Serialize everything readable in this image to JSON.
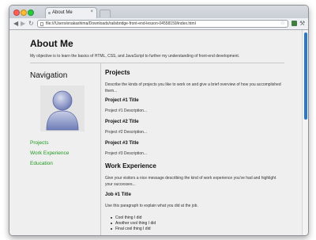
{
  "browser": {
    "tab_title": "About Me",
    "tab_close": "×",
    "url": "file:///Users/enakashima/Downloads/railsbridge-front-end-lesson-04558159/index.html",
    "colors": {
      "close": "#ff5f57",
      "minimize": "#febc2e",
      "zoom": "#28c840",
      "ext1": "#3f7f3f",
      "ext2": "#c44"
    }
  },
  "page": {
    "title": "About Me",
    "objective": "My objective is to learn the basics of HTML, CSS, and JavaScript to further my understanding of front-end development."
  },
  "nav": {
    "title": "Navigation",
    "links": [
      "Projects",
      "Work Experience",
      "Education"
    ],
    "link_color": "#1f9a1f"
  },
  "projects": {
    "heading": "Projects",
    "intro": "Describe the kinds of projects you like to work on and give a brief overview of how you accomplished them...",
    "items": [
      {
        "title": "Project #1 Title",
        "desc": "Project #1 Description..."
      },
      {
        "title": "Project #2 Title",
        "desc": "Project #2 Description..."
      },
      {
        "title": "Project #3 Title",
        "desc": "Project #3 Description..."
      }
    ]
  },
  "work": {
    "heading": "Work Experience",
    "intro": "Give your visitors a nice message describing the kind of work experience you've had and highlight your successes...",
    "job_title": "Job #1 Title",
    "job_desc": "Use this paragraph to explain what you did at the job.",
    "bullets": [
      "Cool thing I did",
      "Another cool thing I did",
      "Final cool thing I did"
    ]
  }
}
